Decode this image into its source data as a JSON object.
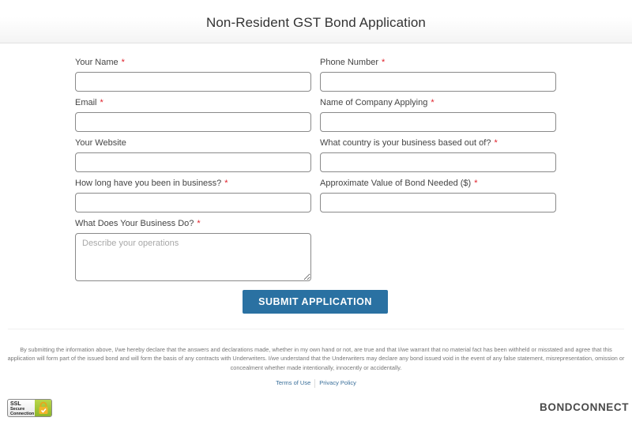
{
  "header": {
    "title": "Non-Resident GST Bond Application"
  },
  "form": {
    "fields": [
      {
        "label": "Your Name",
        "required": "*",
        "value": "",
        "placeholder": ""
      },
      {
        "label": "Phone Number",
        "required": "*",
        "value": "",
        "placeholder": ""
      },
      {
        "label": "Email",
        "required": "*",
        "value": "",
        "placeholder": ""
      },
      {
        "label": "Name of Company Applying",
        "required": "*",
        "value": "",
        "placeholder": ""
      },
      {
        "label": "Your Website",
        "required": "",
        "value": "",
        "placeholder": ""
      },
      {
        "label": "What country is your business based out of?",
        "required": "*",
        "value": "",
        "placeholder": ""
      },
      {
        "label": "How long have you been in business?",
        "required": "*",
        "value": "",
        "placeholder": ""
      },
      {
        "label": "Approximate Value of Bond Needed ($)",
        "required": "*",
        "value": "",
        "placeholder": ""
      },
      {
        "label": "What Does Your Business Do?",
        "required": "*",
        "value": "",
        "placeholder": "Describe your operations"
      }
    ],
    "submit_label": "SUBMIT APPLICATION"
  },
  "disclaimer": "By submitting the information above, I/we hereby declare that the answers and declarations made, whether in my own hand or not, are true and that I/we warrant that no material fact has been withheld or misstated and agree that this application will form part of the issued bond and will form the basis of any contracts with Underwriters. I/we understand that the Underwriters may declare any bond issued void in the event of any false statement, misrepresentation, omission or concealment whether made intentionally, innocently or accidentally.",
  "footer": {
    "links": [
      {
        "label": "Terms of Use"
      },
      {
        "label": "Privacy Policy"
      }
    ],
    "ssl_badge": {
      "line1": "SSL",
      "line2": "Secure",
      "line3": "Connection"
    },
    "brand": "BONDCONNECT"
  },
  "colors": {
    "accent": "#2a71a2",
    "required": "#e0202a",
    "link": "#3a6f9a"
  }
}
